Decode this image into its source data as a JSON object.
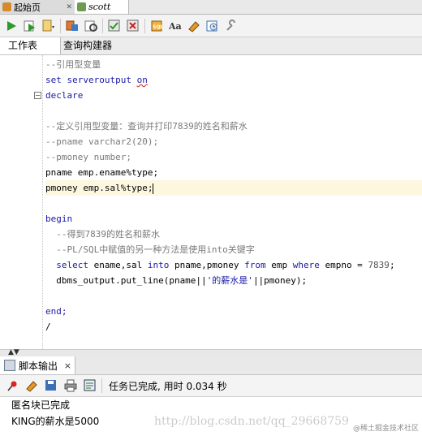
{
  "doc_tabs": [
    {
      "label": "起始页"
    },
    {
      "label": "scott"
    }
  ],
  "subtabs": {
    "worksheet": "工作表",
    "query_builder": "查询构建器"
  },
  "code_lines": [
    "--引用型变量",
    "set serveroutput on",
    "declare",
    "",
    "--定义引用型变量：查询并打印7839的姓名和薪水",
    "--pname varchar2(20);",
    "--pmoney number;",
    "pname emp.ename%type;",
    "pmoney emp.sal%type;",
    "",
    "begin",
    "  --得到7839的姓名和薪水",
    "  --PL/SQL中赋值的另一种方法是使用into关键字",
    "  select ename,sal into pname,pmoney from emp where empno = 7839;",
    "  dbms_output.put_line(pname||'的薪水是'||pmoney);",
    "",
    "end;",
    "/"
  ],
  "output": {
    "tab_label": "脚本输出",
    "status": "任务已完成, 用时 0.034 秒",
    "lines": [
      "匿名块已完成",
      "KING的薪水是5000"
    ],
    "watermark": "http://blog.csdn.net/qq_29668759",
    "watermark2": "@稀土掘金技术社区"
  },
  "colors": {
    "keyword": "#1a1aa6",
    "comment": "#7a7a7a",
    "current_line": "#fdf7e0"
  }
}
